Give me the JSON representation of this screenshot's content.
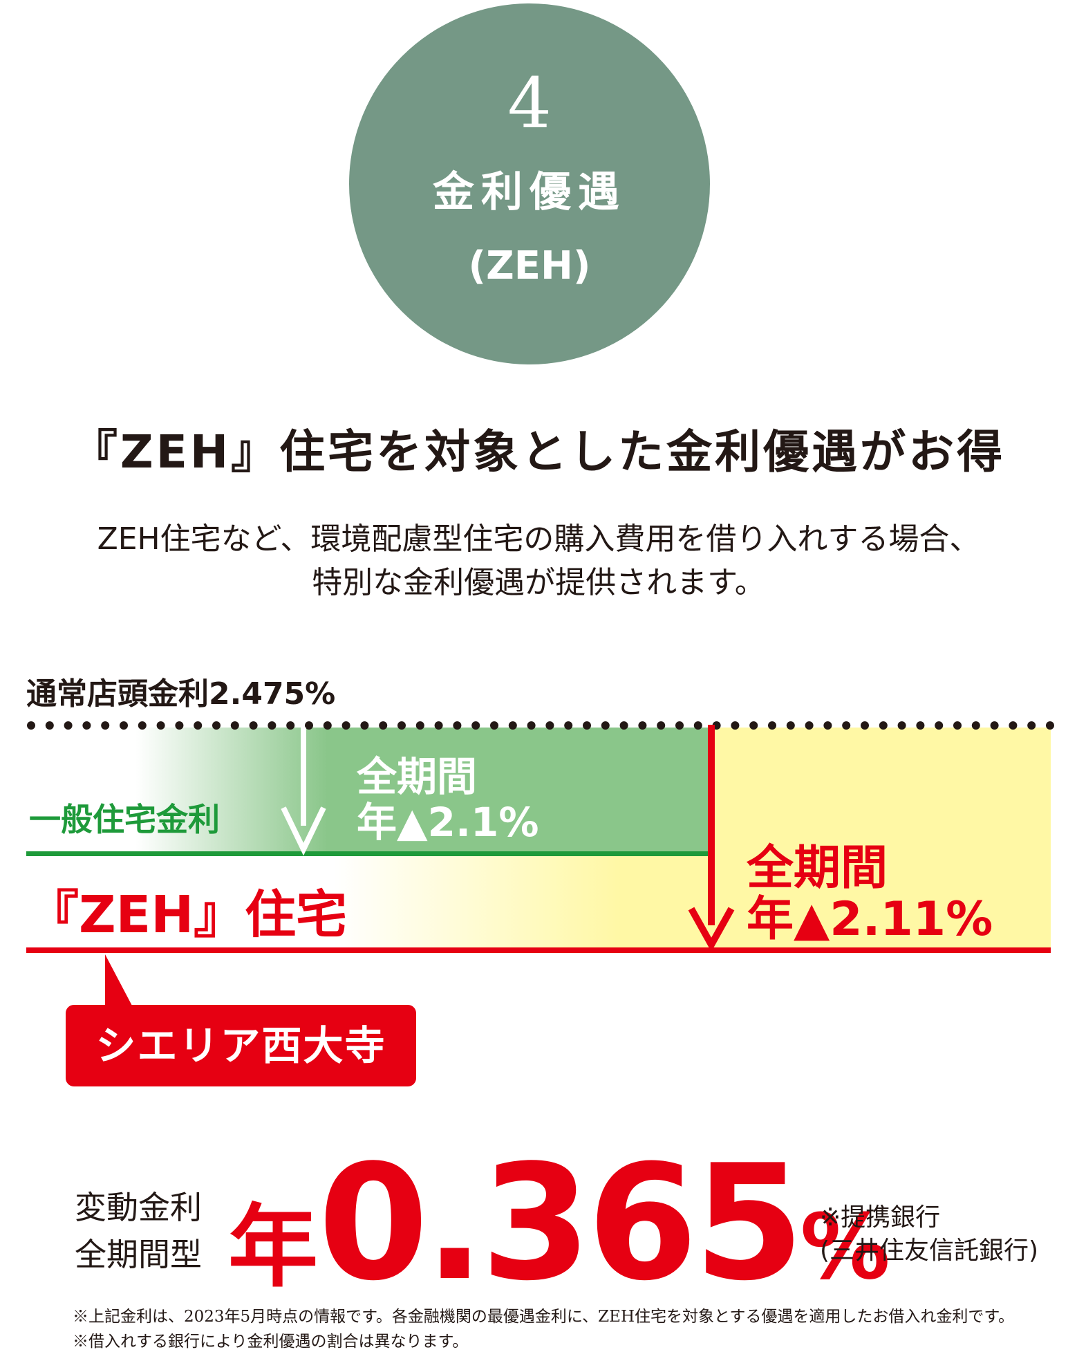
{
  "badge": {
    "number": "4",
    "title": "金利優遇",
    "subtitle": "(ZEH)"
  },
  "headline": "『ZEH』住宅を対象とした金利優遇がお得",
  "intro": {
    "line1": "ZEH住宅など、環境配慮型住宅の購入費用を借り入れする場合、",
    "line2": "特別な金利優遇が提供されます。"
  },
  "comparison": {
    "standard_rate_label": "通常店頭金利2.475%",
    "general_label": "一般住宅金利",
    "general_discount_line1": "全期間",
    "general_discount_line2": "年▲2.1%",
    "zeh_label": "『ZEH』住宅",
    "zeh_discount_line1": "全期間",
    "zeh_discount_line2": "年▲2.11%",
    "general_discount_value": 2.1,
    "zeh_discount_value": 2.11,
    "standard_rate_value": 2.475
  },
  "callout": {
    "label": "シエリア西大寺"
  },
  "rate": {
    "type_line1": "変動金利",
    "type_line2": "全期間型",
    "prefix": "年",
    "value": "0.365",
    "suffix": "%",
    "note_line1": "※提携銀行",
    "note_line2": "(三井住友信託銀行)"
  },
  "footnotes": {
    "line1": "※上記金利は、2023年5月時点の情報です。各金融機関の最優遇金利に、ZEH住宅を対象とする優遇を適用したお借入れ金利です。",
    "line2": "※借入れする銀行により金利優遇の割合は異なります。"
  },
  "colors": {
    "badge": "#759886",
    "accent_red": "#e60012",
    "general_green": "#1e9a3a",
    "green_band": "#8ac68a",
    "yellow_band": "#fff8a5"
  }
}
